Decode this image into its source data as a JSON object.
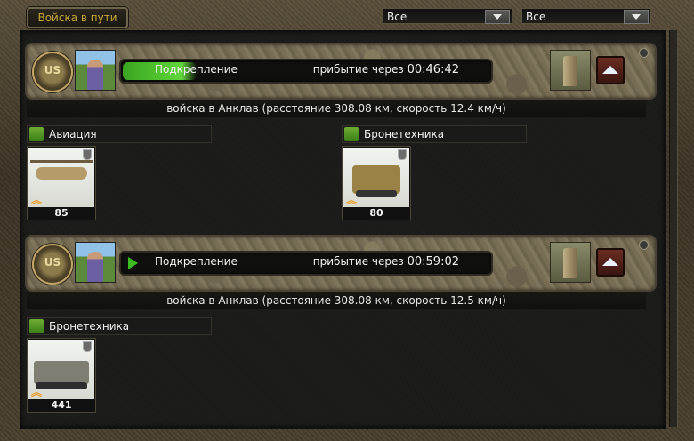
{
  "tab_label": "Войска в пути",
  "filters": [
    {
      "selected": "Все"
    },
    {
      "selected": "Все"
    }
  ],
  "movements": [
    {
      "type_label": "Подкрепление",
      "eta_prefix": "прибытие через",
      "eta": "00:46:42",
      "progress": 0.2,
      "destination": "войска в Анклав  (расстояние 308.08 км, скорость 12.4 км/ч)",
      "groups": [
        {
          "name": "Авиация",
          "units": [
            {
              "count": "85"
            }
          ]
        },
        {
          "name": "Бронетехника",
          "units": [
            {
              "count": "80"
            }
          ]
        }
      ]
    },
    {
      "type_label": "Подкрепление",
      "eta_prefix": "прибытие через",
      "eta": "00:59:02",
      "progress": 0.0,
      "destination": "войска в Анклав  (расстояние 308.08 км, скорость 12.5 км/ч)",
      "groups": [
        {
          "name": "Бронетехника",
          "units": [
            {
              "count": "441"
            }
          ]
        }
      ]
    }
  ],
  "colors": {
    "accent_gold": "#c7a83a",
    "progress_green": "#3cbc23"
  },
  "icons": {
    "emblem": "army-emblem-icon",
    "collapse": "chevron-up-icon",
    "aviation": "aviation-wings-icon",
    "armor": "tank-icon",
    "rank": "rank-chevron-icon",
    "shield": "shield-icon"
  }
}
